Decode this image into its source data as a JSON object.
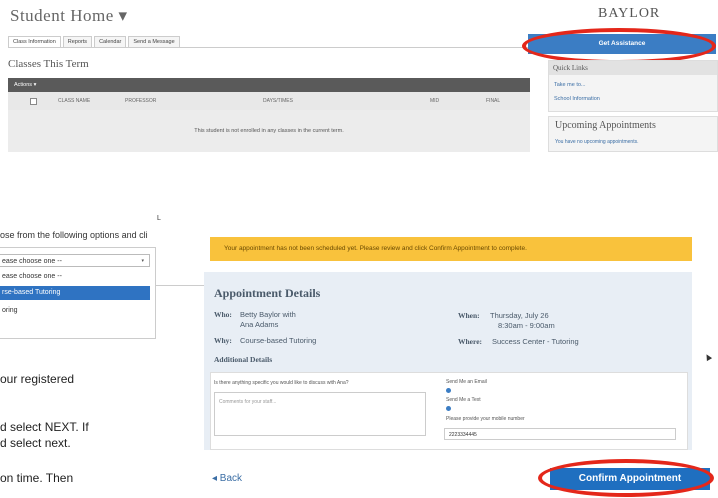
{
  "top": {
    "title": "Student Home ▾",
    "tabs": [
      "Class Information",
      "Reports",
      "Calendar",
      "Send a Message"
    ],
    "classes_title": "Classes This Term",
    "actions_label": "Actions ▾",
    "columns": [
      "CLASS NAME",
      "PROFESSOR",
      "DAYS/TIMES",
      "MID",
      "FINAL"
    ],
    "no_classes": "This student is not enrolled in any classes in the current term."
  },
  "side": {
    "brand": "BAYLOR",
    "assist_button": "Get Assistance",
    "quick_links_header": "Quick Links",
    "quick_links": [
      "Take me to...",
      "School Information"
    ],
    "upcoming_header": "Upcoming Appointments",
    "upcoming_text": "You have no upcoming appointments."
  },
  "choose": {
    "prompt": "ose from the following options and cli",
    "marker": "L",
    "select_value": "ease choose one --",
    "options": [
      "ease choose one --",
      "rse-based Tutoring",
      "oring"
    ]
  },
  "instructions": [
    "our registered",
    "d select NEXT. If",
    "d select next.",
    "on time. Then"
  ],
  "appointment": {
    "warning": "Your appointment has not been scheduled yet. Please review and click Confirm Appointment to complete.",
    "title": "Appointment Details",
    "who_label": "Who:",
    "who_value_1": "Betty Baylor with",
    "who_value_2": "Ana Adams",
    "why_label": "Why:",
    "why_value": "Course-based Tutoring",
    "when_label": "When:",
    "when_value_1": "Thursday, July 26",
    "when_value_2": "8:30am - 9:00am",
    "where_label": "Where:",
    "where_value": "Success Center - Tutoring",
    "additional_header": "Additional Details",
    "question": "Is there anything specific you would like to discuss with Ana?",
    "comment_placeholder": "Comments for your staff...",
    "email_label": "Send Me an Email",
    "text_label": "Send Me a Text",
    "phone_label": "Please provide your mobile number",
    "phone_value": "2223334445",
    "back_label": "◂ Back",
    "confirm_label": "Confirm Appointment"
  },
  "colors": {
    "accent_blue": "#3b7dc4",
    "highlight_red": "#e4271a",
    "warning_yellow": "#f9c23c"
  }
}
